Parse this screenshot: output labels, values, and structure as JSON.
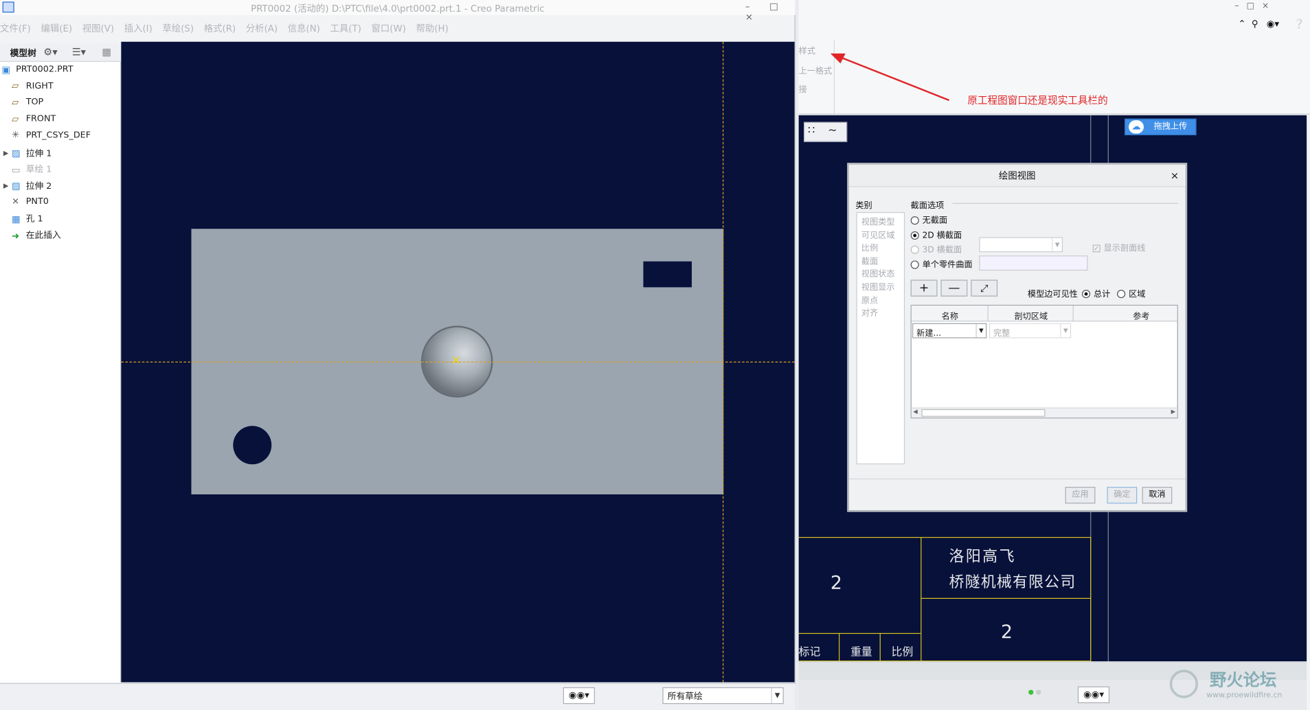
{
  "left_window": {
    "title": "PRT0002 (活动的) D:\\PTC\\file\\4.0\\prt0002.prt.1 - Creo Parametric",
    "window_controls": "– □ ×",
    "menu": [
      "文件(F)",
      "编辑(E)",
      "视图(V)",
      "插入(I)",
      "草绘(S)",
      "格式(R)",
      "分析(A)",
      "信息(N)",
      "工具(T)",
      "窗口(W)",
      "帮助(H)"
    ],
    "tree_header": "模型树",
    "tree_items": [
      {
        "label": "PRT0002.PRT",
        "icon": "part-icon",
        "dim": false,
        "expander": false
      },
      {
        "label": "RIGHT",
        "icon": "datum-plane-icon",
        "dim": false,
        "expander": false
      },
      {
        "label": "TOP",
        "icon": "datum-plane-icon",
        "dim": false,
        "expander": false
      },
      {
        "label": "FRONT",
        "icon": "datum-plane-icon",
        "dim": false,
        "expander": false
      },
      {
        "label": "PRT_CSYS_DEF",
        "icon": "csys-icon",
        "dim": false,
        "expander": false
      },
      {
        "label": "拉伸 1",
        "icon": "extrude-icon",
        "dim": false,
        "expander": true
      },
      {
        "label": "草绘 1",
        "icon": "sketch-icon",
        "dim": true,
        "expander": false
      },
      {
        "label": "拉伸 2",
        "icon": "extrude-icon",
        "dim": false,
        "expander": true
      },
      {
        "label": "PNT0",
        "icon": "datum-point-icon",
        "dim": false,
        "expander": false
      },
      {
        "label": "孔 1",
        "icon": "hole-icon",
        "dim": false,
        "expander": false
      },
      {
        "label": "在此插入",
        "icon": "insert-here-icon",
        "dim": false,
        "expander": false
      }
    ],
    "filter_value": "所有草绘"
  },
  "right_window": {
    "ribbon_fragments": [
      "样式",
      "上一格式",
      "接"
    ],
    "annotation": "原工程图窗口还是现实工具栏的",
    "upload_button": "拖拽上传",
    "title_block": {
      "company_line1": "洛阳高飞",
      "company_line2": "桥隧机械有限公司",
      "num_left": "2",
      "num_right": "2",
      "col_mark": "标记",
      "col_weight": "重量",
      "col_scale": "比例"
    },
    "watermark_main": "野火论坛",
    "watermark_url": "www.proewildfire.cn"
  },
  "dialog": {
    "title": "绘图视图",
    "close": "×",
    "categories_label": "类别",
    "categories": [
      "视图类型",
      "可见区域",
      "比例",
      "截面",
      "视图状态",
      "视图显示",
      "原点",
      "对齐"
    ],
    "section_options_label": "截面选项",
    "opt_none": "无截面",
    "opt_2d": "2D 横截面",
    "opt_3d": "3D 横截面",
    "opt_single": "单个零件曲面",
    "show_hatch": "显示剖面线",
    "edge_vis_label": "模型边可见性",
    "edge_total": "总计",
    "edge_area": "区域",
    "col_name": "名称",
    "col_cut": "剖切区域",
    "col_ref": "参考",
    "row_name": "新建...",
    "row_cut": "完整",
    "btn_apply": "应用",
    "btn_ok": "确定",
    "btn_cancel": "取消"
  }
}
